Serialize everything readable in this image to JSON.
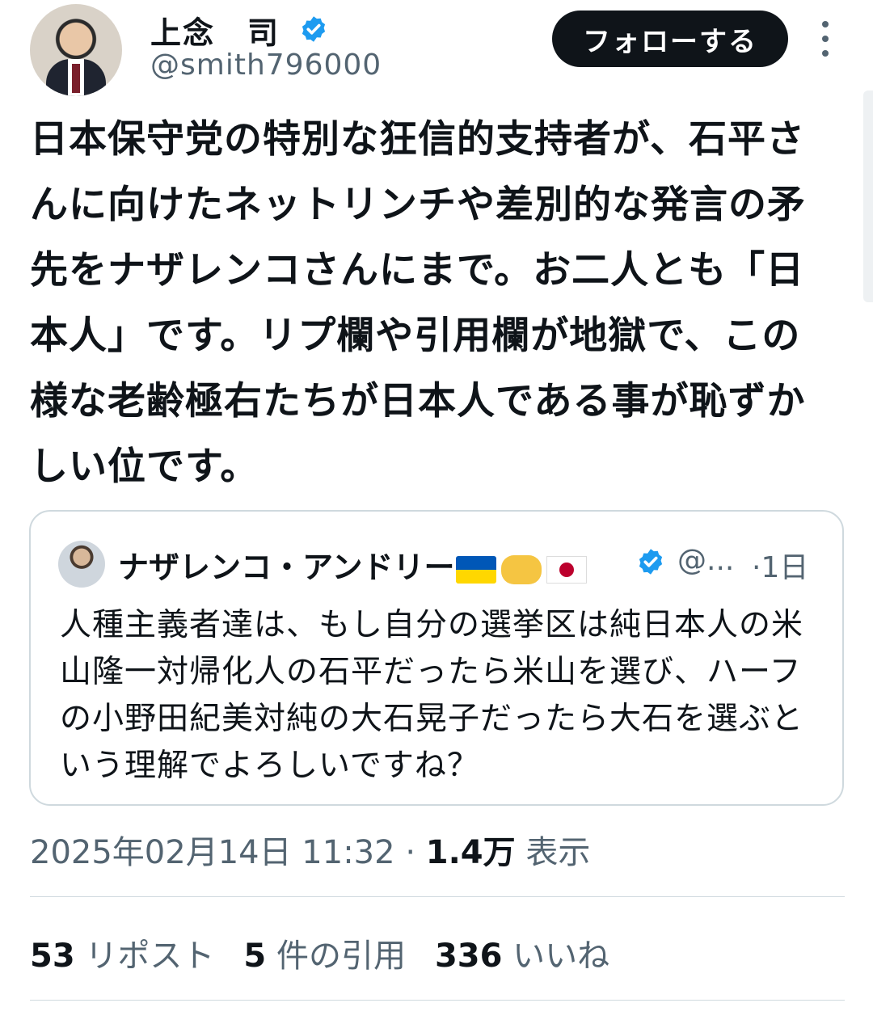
{
  "author": {
    "name": "上念　司",
    "handle": "@smith796000"
  },
  "follow_label": "フォローする",
  "tweet_text": "日本保守党の特別な狂信的支持者が、石平さんに向けたネットリンチや差別的な発言の矛先をナザレンコさんにまで。お二人とも「日本人」です。リプ欄や引用欄が地獄で、この様な老齢極右たちが日本人である事が恥ずかしい位です。",
  "quote": {
    "name": "ナザレンコ・アンドリー",
    "handle": "@...",
    "time": "·1日",
    "text": "人種主義者達は、もし自分の選挙区は純日本人の米山隆一対帰化人の石平だったら米山を選び、ハーフの小野田紀美対純の大石晃子だったら大石を選ぶという理解でよろしいですね？",
    "name_emojis": [
      "ukraine-flag",
      "handshake",
      "japan-flag"
    ]
  },
  "meta": {
    "timestamp": "2025年02月14日 11:32",
    "separator": "·",
    "views": "1.4万",
    "views_label": "表示"
  },
  "stats": {
    "reposts_count": "53",
    "reposts_label": "リポスト",
    "quotes_count": "5",
    "quotes_label": "件の引用",
    "likes_count": "336",
    "likes_label": "いいね"
  },
  "colors": {
    "verified": "#1d9bf0",
    "follow_bg": "#0f1419",
    "secondary_text": "#536471",
    "border": "#cfd9de"
  }
}
